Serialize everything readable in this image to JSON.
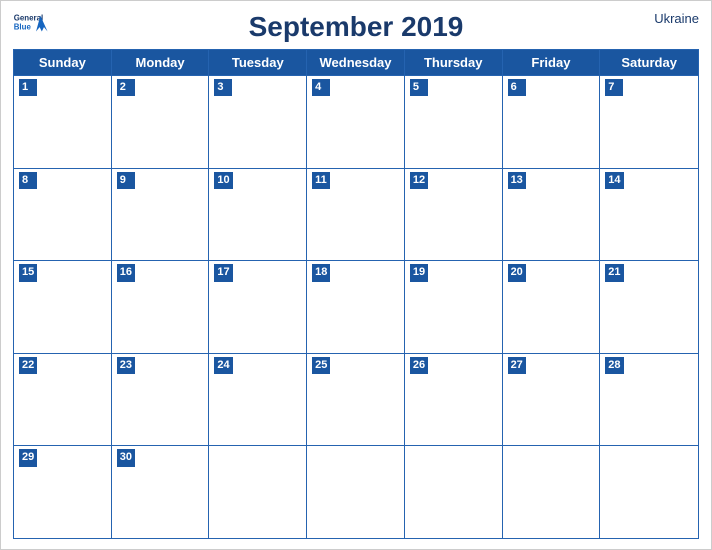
{
  "header": {
    "logo_general": "General",
    "logo_blue": "Blue",
    "title": "September 2019",
    "country": "Ukraine"
  },
  "days_of_week": [
    "Sunday",
    "Monday",
    "Tuesday",
    "Wednesday",
    "Thursday",
    "Friday",
    "Saturday"
  ],
  "weeks": [
    [
      {
        "num": "1",
        "empty": false
      },
      {
        "num": "2",
        "empty": false
      },
      {
        "num": "3",
        "empty": false
      },
      {
        "num": "4",
        "empty": false
      },
      {
        "num": "5",
        "empty": false
      },
      {
        "num": "6",
        "empty": false
      },
      {
        "num": "7",
        "empty": false
      }
    ],
    [
      {
        "num": "8",
        "empty": false
      },
      {
        "num": "9",
        "empty": false
      },
      {
        "num": "10",
        "empty": false
      },
      {
        "num": "11",
        "empty": false
      },
      {
        "num": "12",
        "empty": false
      },
      {
        "num": "13",
        "empty": false
      },
      {
        "num": "14",
        "empty": false
      }
    ],
    [
      {
        "num": "15",
        "empty": false
      },
      {
        "num": "16",
        "empty": false
      },
      {
        "num": "17",
        "empty": false
      },
      {
        "num": "18",
        "empty": false
      },
      {
        "num": "19",
        "empty": false
      },
      {
        "num": "20",
        "empty": false
      },
      {
        "num": "21",
        "empty": false
      }
    ],
    [
      {
        "num": "22",
        "empty": false
      },
      {
        "num": "23",
        "empty": false
      },
      {
        "num": "24",
        "empty": false
      },
      {
        "num": "25",
        "empty": false
      },
      {
        "num": "26",
        "empty": false
      },
      {
        "num": "27",
        "empty": false
      },
      {
        "num": "28",
        "empty": false
      }
    ],
    [
      {
        "num": "29",
        "empty": false
      },
      {
        "num": "30",
        "empty": false
      },
      {
        "num": "",
        "empty": true
      },
      {
        "num": "",
        "empty": true
      },
      {
        "num": "",
        "empty": true
      },
      {
        "num": "",
        "empty": true
      },
      {
        "num": "",
        "empty": true
      }
    ]
  ],
  "colors": {
    "header_bg": "#1a56a0",
    "header_text": "#ffffff",
    "title_color": "#1a3a6b",
    "border_color": "#2563b0",
    "day_number_bg": "#1a56a0"
  }
}
